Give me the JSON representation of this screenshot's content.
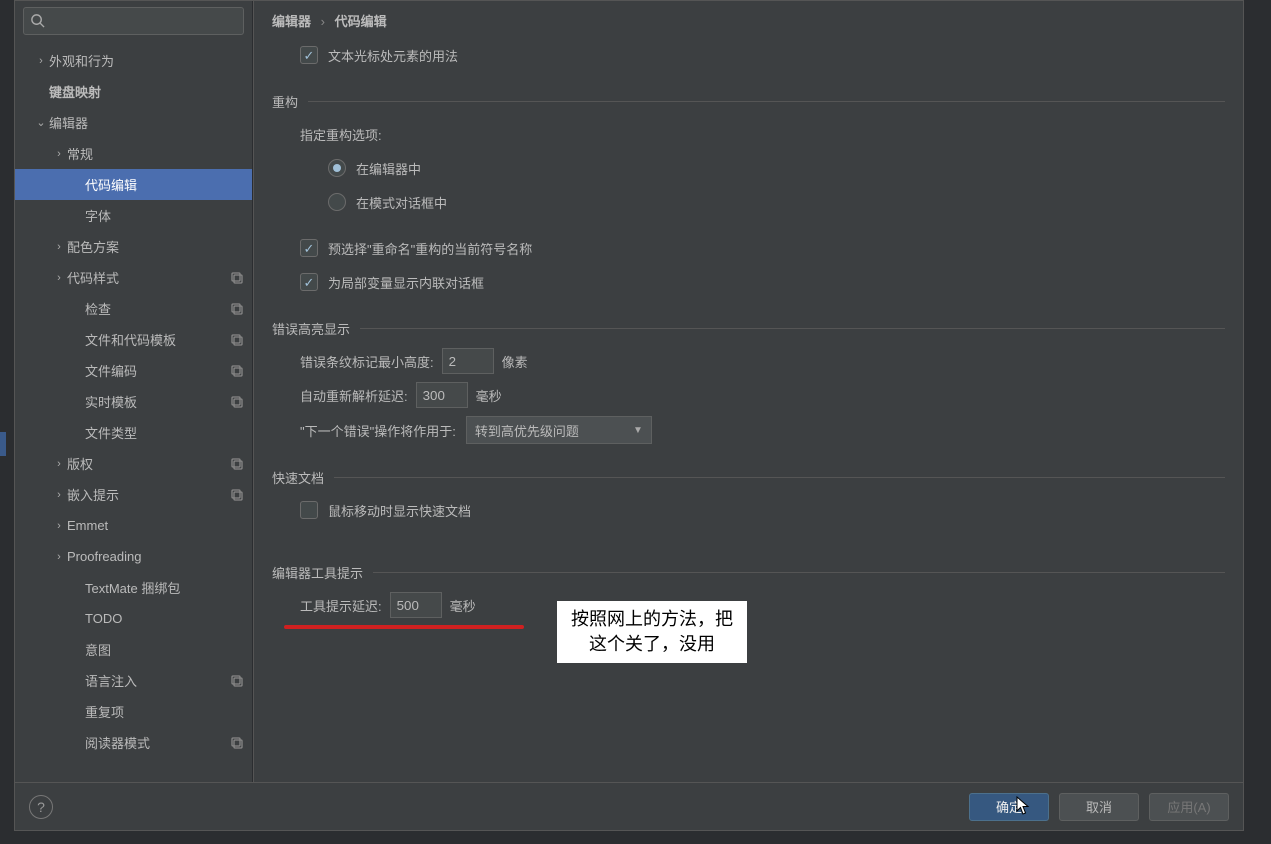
{
  "breadcrumb": {
    "a": "编辑器",
    "b": "代码编辑"
  },
  "sidebar": {
    "search_placeholder": "",
    "items": [
      {
        "label": "外观和行为",
        "lvl": 0,
        "arrow": ">",
        "copy": false
      },
      {
        "label": "键盘映射",
        "lvl": 0,
        "arrow": "",
        "copy": false,
        "bold": true
      },
      {
        "label": "编辑器",
        "lvl": 0,
        "arrow": "v",
        "copy": false
      },
      {
        "label": "常规",
        "lvl": 1,
        "arrow": ">",
        "copy": false
      },
      {
        "label": "代码编辑",
        "lvl": 2,
        "arrow": "",
        "copy": false,
        "selected": true
      },
      {
        "label": "字体",
        "lvl": 2,
        "arrow": "",
        "copy": false
      },
      {
        "label": "配色方案",
        "lvl": 1,
        "arrow": ">",
        "copy": false
      },
      {
        "label": "代码样式",
        "lvl": 1,
        "arrow": ">",
        "copy": true
      },
      {
        "label": "检查",
        "lvl": 2,
        "arrow": "",
        "copy": true
      },
      {
        "label": "文件和代码模板",
        "lvl": 2,
        "arrow": "",
        "copy": true
      },
      {
        "label": "文件编码",
        "lvl": 2,
        "arrow": "",
        "copy": true
      },
      {
        "label": "实时模板",
        "lvl": 2,
        "arrow": "",
        "copy": true
      },
      {
        "label": "文件类型",
        "lvl": 2,
        "arrow": "",
        "copy": false
      },
      {
        "label": "版权",
        "lvl": 1,
        "arrow": ">",
        "copy": true
      },
      {
        "label": "嵌入提示",
        "lvl": 1,
        "arrow": ">",
        "copy": true
      },
      {
        "label": "Emmet",
        "lvl": 1,
        "arrow": ">",
        "copy": false
      },
      {
        "label": "Proofreading",
        "lvl": 1,
        "arrow": ">",
        "copy": false
      },
      {
        "label": "TextMate 捆绑包",
        "lvl": 2,
        "arrow": "",
        "copy": false
      },
      {
        "label": "TODO",
        "lvl": 2,
        "arrow": "",
        "copy": false
      },
      {
        "label": "意图",
        "lvl": 2,
        "arrow": "",
        "copy": false
      },
      {
        "label": "语言注入",
        "lvl": 2,
        "arrow": "",
        "copy": true
      },
      {
        "label": "重复项",
        "lvl": 2,
        "arrow": "",
        "copy": false
      },
      {
        "label": "阅读器模式",
        "lvl": 2,
        "arrow": "",
        "copy": true
      }
    ]
  },
  "top_check": {
    "label": "文本光标处元素的用法",
    "checked": true
  },
  "refactor": {
    "title": "重构",
    "specify_label": "指定重构选项:",
    "opt_editor": "在编辑器中",
    "opt_modal": "在模式对话框中",
    "preselect": {
      "label": "预选择\"重命名\"重构的当前符号名称",
      "checked": true
    },
    "inline": {
      "label": "为局部变量显示内联对话框",
      "checked": true
    }
  },
  "errors": {
    "title": "错误高亮显示",
    "min_height_label": "错误条纹标记最小高度:",
    "min_height_value": "2",
    "min_height_unit": "像素",
    "reparse_label": "自动重新解析延迟:",
    "reparse_value": "300",
    "reparse_unit": "毫秒",
    "next_err_label": "\"下一个错误\"操作将作用于:",
    "next_err_value": "转到高优先级问题"
  },
  "quickdoc": {
    "title": "快速文档",
    "hover": {
      "label": "鼠标移动时显示快速文档",
      "checked": false
    }
  },
  "tooltips": {
    "title": "编辑器工具提示",
    "delay_label": "工具提示延迟:",
    "delay_value": "500",
    "delay_unit": "毫秒"
  },
  "annotation": {
    "line1": "按照网上的方法，把",
    "line2": "这个关了，没用"
  },
  "footer": {
    "ok": "确定",
    "cancel": "取消",
    "apply": "应用(A)"
  }
}
